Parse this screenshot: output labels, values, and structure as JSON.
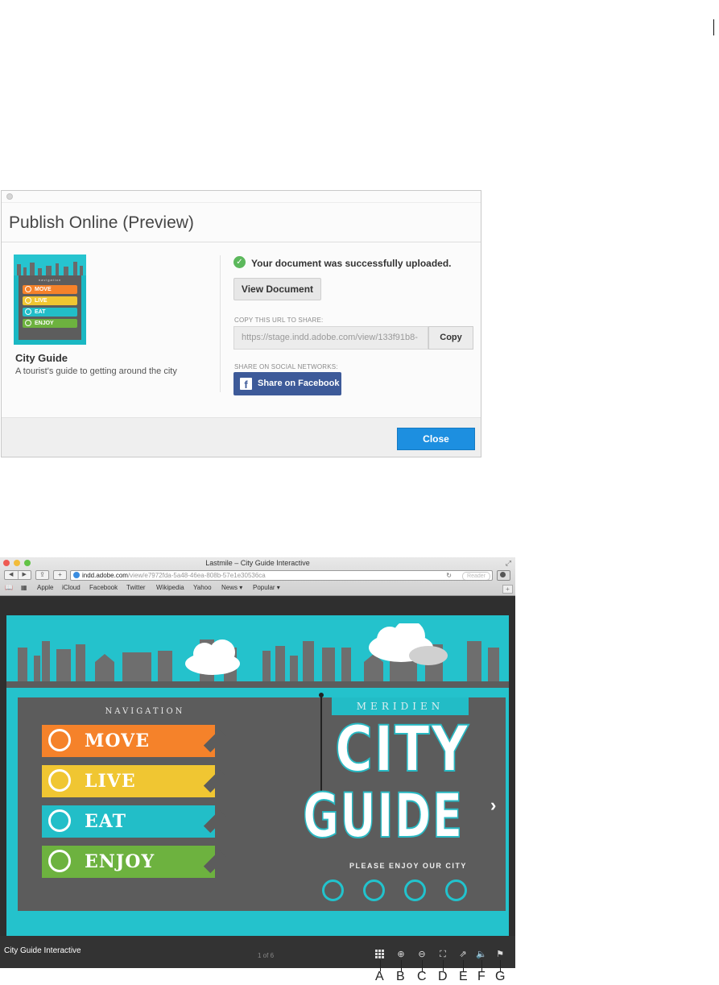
{
  "dialog": {
    "title": "Publish Online (Preview)",
    "document": {
      "title": "City Guide",
      "description": "A tourist's guide to getting around the city",
      "thumbnail": {
        "label": "navigation",
        "items": [
          "MOVE",
          "LIVE",
          "EAT",
          "ENJOY"
        ]
      }
    },
    "status_message": "Your document was successfully uploaded.",
    "view_button": "View Document",
    "url_caption": "COPY THIS URL TO SHARE:",
    "url_value": "https://stage.indd.adobe.com/view/133f91b8-",
    "copy_button": "Copy",
    "social_caption": "SHARE ON SOCIAL NETWORKS:",
    "facebook_button": "Share on Facebook",
    "close_button": "Close"
  },
  "browser": {
    "window_title": "Lastmile – City Guide Interactive",
    "address": {
      "domain": "indd.adobe.com",
      "path": "/view/e7972fda-5a48-46ea-808b-57e1e30536ca"
    },
    "reader_label": "Reader",
    "bookmarks": [
      "Apple",
      "iCloud",
      "Facebook",
      "Twitter",
      "Wikipedia",
      "Yahoo",
      "News ▾",
      "Popular ▾"
    ],
    "page": {
      "nav_heading": "NAVIGATION",
      "nav_items": [
        "MOVE",
        "LIVE",
        "EAT",
        "ENJOY"
      ],
      "brand": "MERIDIEN",
      "hero_line1": "CITY",
      "hero_line2": "GUIDE",
      "tagline": "PLEASE ENJOY OUR CITY"
    },
    "statusbar": {
      "publication_title": "City Guide Interactive",
      "page_count": "1 of 6"
    }
  },
  "callouts": [
    "A",
    "B",
    "C",
    "D",
    "E",
    "F",
    "G"
  ],
  "colors": {
    "move": "#f5822a",
    "live": "#f0c632",
    "eat": "#22bec8",
    "enjoy": "#6db23f",
    "close_button": "#1d8fe0",
    "facebook": "#3d5a99",
    "teal_background": "#24c2cc"
  }
}
